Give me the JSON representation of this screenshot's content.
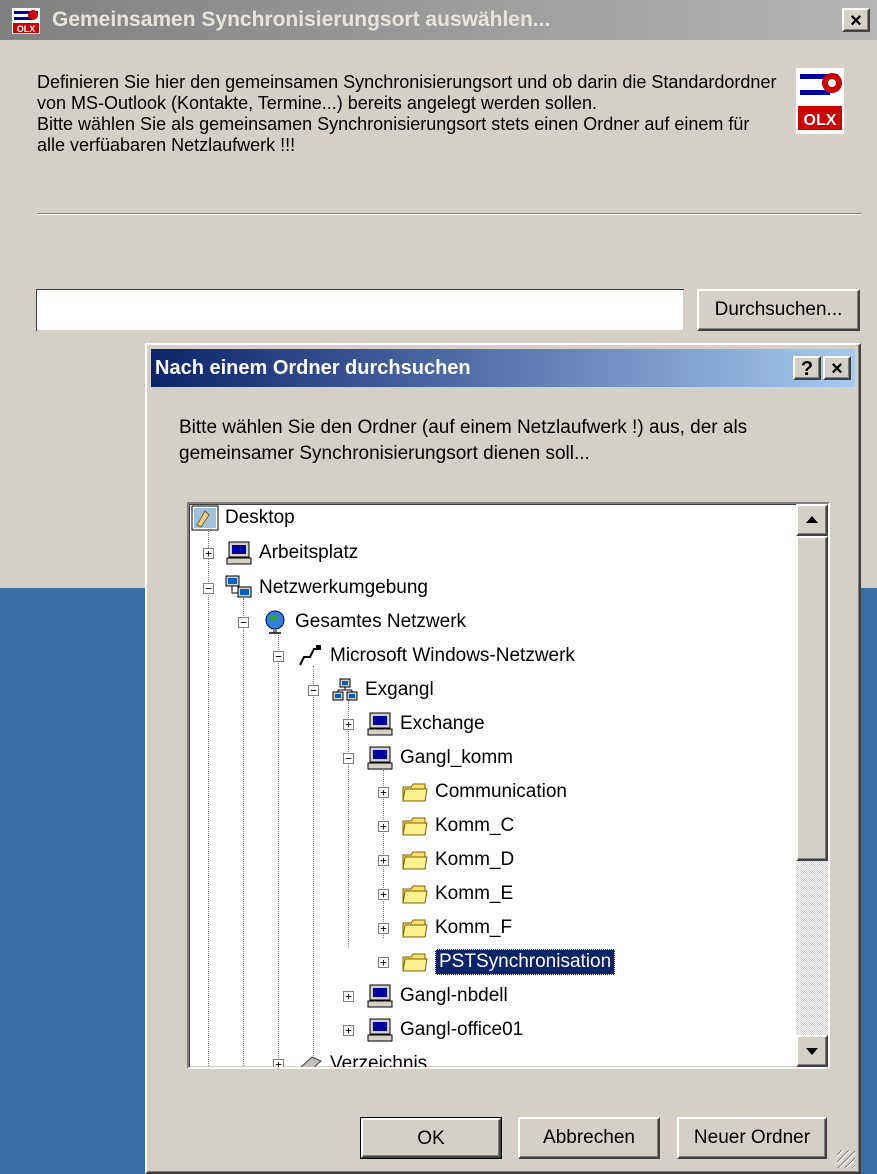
{
  "main_dialog": {
    "title": "Gemeinsamen Synchronisierungsort auswählen...",
    "close_label": "×",
    "description": "Definieren Sie hier den gemeinsamen Synchronisierungsort und ob darin die Standardordner von MS-Outlook (Kontakte, Termine...) bereits angelegt werden sollen.\nBitte wählen Sie als gemeinsamen Synchronisierungsort stets einen Ordner auf einem für alle verfüabaren Netzlaufwerk !!!",
    "path_value": "",
    "browse_label": "Durchsuchen...",
    "logo_text": "OLX"
  },
  "browse_dialog": {
    "title": "Nach einem Ordner durchsuchen",
    "help_label": "?",
    "close_label": "×",
    "description": "Bitte wählen Sie den Ordner (auf einem Netzlaufwerk !) aus, der als gemeinsamer Synchronisierungsort dienen soll...",
    "tree": [
      {
        "label": "Desktop",
        "icon": "desktop-icon"
      },
      {
        "label": "Arbeitsplatz",
        "icon": "computer-icon"
      },
      {
        "label": "Netzwerkumgebung",
        "icon": "network-places-icon"
      },
      {
        "label": "Gesamtes Netzwerk",
        "icon": "globe-icon"
      },
      {
        "label": "Microsoft Windows-Netzwerk",
        "icon": "network-icon"
      },
      {
        "label": "Exgangl",
        "icon": "workgroup-icon"
      },
      {
        "label": "Exchange",
        "icon": "computer-icon"
      },
      {
        "label": "Gangl_komm",
        "icon": "computer-icon"
      },
      {
        "label": "Communication",
        "icon": "shared-folder-icon"
      },
      {
        "label": "Komm_C",
        "icon": "shared-folder-icon"
      },
      {
        "label": "Komm_D",
        "icon": "shared-folder-icon"
      },
      {
        "label": "Komm_E",
        "icon": "shared-folder-icon"
      },
      {
        "label": "Komm_F",
        "icon": "shared-folder-icon"
      },
      {
        "label": "PSTSynchronisation",
        "icon": "shared-folder-icon",
        "selected": true
      },
      {
        "label": "Gangl-nbdell",
        "icon": "computer-icon"
      },
      {
        "label": "Gangl-office01",
        "icon": "computer-icon"
      },
      {
        "label": "Verzeichnis",
        "icon": "directory-icon"
      }
    ],
    "ok_label": "OK",
    "cancel_label": "Abbrechen",
    "new_folder_label": "Neuer Ordner"
  },
  "colors": {
    "desktop": "#3a6ea5",
    "face": "#d4d0c8",
    "active_title": "#0a246a",
    "selection": "#0a246a"
  }
}
